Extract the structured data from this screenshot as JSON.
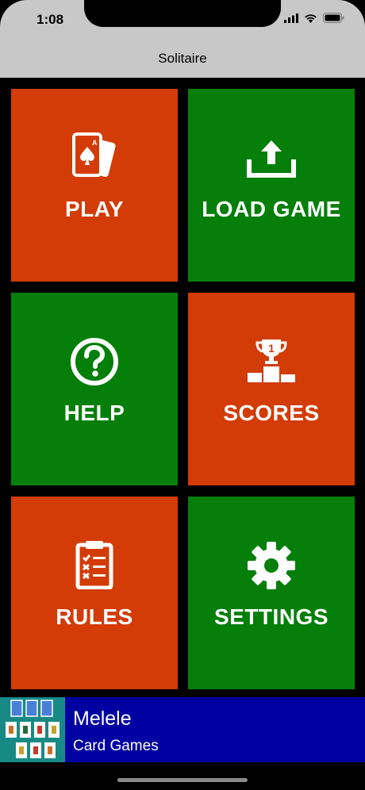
{
  "status_bar": {
    "time": "1:08"
  },
  "nav": {
    "title": "Solitaire"
  },
  "tiles": [
    {
      "label": "PLAY",
      "icon": "playing-cards-icon",
      "color": "#d33b07"
    },
    {
      "label": "LOAD GAME",
      "icon": "upload-icon",
      "color": "#057f0a"
    },
    {
      "label": "HELP",
      "icon": "question-circle-icon",
      "color": "#057f0a"
    },
    {
      "label": "SCORES",
      "icon": "trophy-podium-icon",
      "color": "#d33b07"
    },
    {
      "label": "RULES",
      "icon": "clipboard-checklist-icon",
      "color": "#d33b07"
    },
    {
      "label": "SETTINGS",
      "icon": "gear-icon",
      "color": "#057f0a"
    }
  ],
  "ad": {
    "title": "Melele",
    "subtitle": "Card Games",
    "background": "#0000a2"
  }
}
